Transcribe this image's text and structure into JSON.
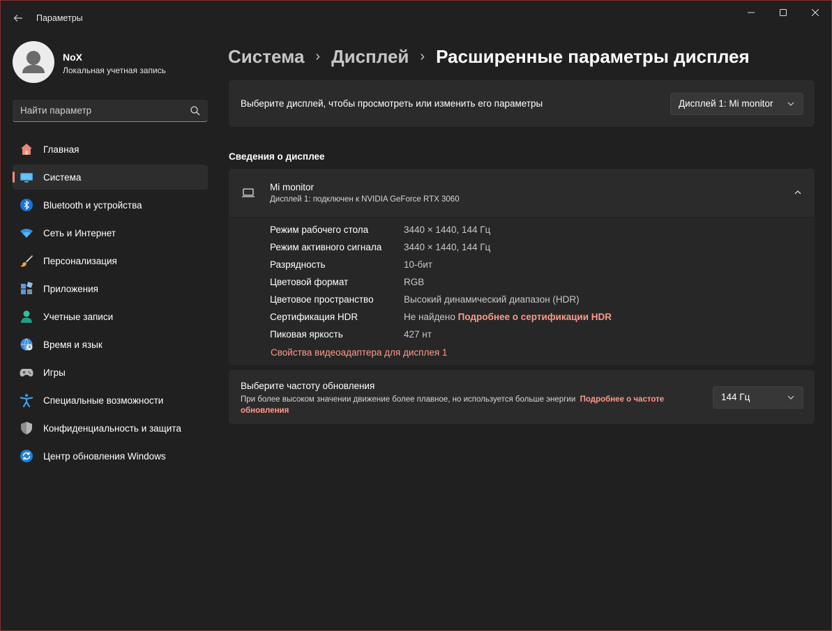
{
  "window": {
    "title": "Параметры"
  },
  "user": {
    "name": "NoX",
    "account_type": "Локальная учетная запись"
  },
  "search": {
    "placeholder": "Найти параметр"
  },
  "sidebar": {
    "items": [
      {
        "label": "Главная",
        "icon": "home-icon",
        "active": false
      },
      {
        "label": "Система",
        "icon": "system-icon",
        "active": true
      },
      {
        "label": "Bluetooth и устройства",
        "icon": "bluetooth-icon",
        "active": false
      },
      {
        "label": "Сеть и Интернет",
        "icon": "wifi-icon",
        "active": false
      },
      {
        "label": "Персонализация",
        "icon": "brush-icon",
        "active": false
      },
      {
        "label": "Приложения",
        "icon": "apps-icon",
        "active": false
      },
      {
        "label": "Учетные записи",
        "icon": "accounts-icon",
        "active": false
      },
      {
        "label": "Время и язык",
        "icon": "time-language-icon",
        "active": false
      },
      {
        "label": "Игры",
        "icon": "gamepad-icon",
        "active": false
      },
      {
        "label": "Специальные возможности",
        "icon": "accessibility-icon",
        "active": false
      },
      {
        "label": "Конфиденциальность и защита",
        "icon": "shield-icon",
        "active": false
      },
      {
        "label": "Центр обновления Windows",
        "icon": "update-icon",
        "active": false
      }
    ]
  },
  "breadcrumb": {
    "items": [
      "Система",
      "Дисплей"
    ],
    "current": "Расширенные параметры дисплея",
    "separator": "›"
  },
  "display_select": {
    "prompt": "Выберите дисплей, чтобы просмотреть или изменить его параметры",
    "selected": "Дисплей 1: Mi monitor"
  },
  "display_info": {
    "section_title": "Сведения о дисплее",
    "monitor_name": "Mi monitor",
    "monitor_subtitle": "Дисплей 1: подключен к NVIDIA GeForce RTX 3060",
    "rows": [
      {
        "key": "Режим рабочего стола",
        "value": "3440 × 1440, 144 Гц"
      },
      {
        "key": "Режим активного сигнала",
        "value": "3440 × 1440, 144 Гц"
      },
      {
        "key": "Разрядность",
        "value": "10-бит"
      },
      {
        "key": "Цветовой формат",
        "value": "RGB"
      },
      {
        "key": "Цветовое пространство",
        "value": "Высокий динамический диапазон (HDR)"
      },
      {
        "key": "Сертификация HDR",
        "value": "Не найдено",
        "link": "Подробнее о сертификации HDR"
      },
      {
        "key": "Пиковая яркость",
        "value": "427 нт"
      }
    ],
    "adapter_link": "Свойства видеоадаптера для дисплея 1"
  },
  "refresh_rate": {
    "title": "Выберите частоту обновления",
    "description": "При более высоком значении движение более плавное, но используется больше энергии",
    "link": "Подробнее о частоте обновления",
    "selected": "144 Гц"
  },
  "colors": {
    "accent": "#ff9a8a",
    "background": "#202020",
    "card": "#2b2b2b"
  }
}
